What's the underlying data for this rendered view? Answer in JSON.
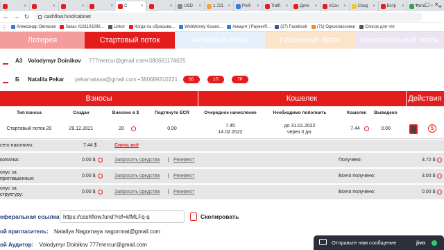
{
  "browser": {
    "tabs": [
      {
        "label": "",
        "color": "#e51c1c"
      },
      {
        "label": "",
        "color": "#e51c1c"
      },
      {
        "label": "",
        "color": "#e51c1c"
      },
      {
        "label": "",
        "color": "#e51c1c"
      },
      {
        "label": "C",
        "color": "#e51c1c",
        "active": true
      },
      {
        "label": "",
        "color": "#e51c1c"
      },
      {
        "label": "USD",
        "color": "#888888"
      },
      {
        "label": "1.721",
        "color": "#f2a33a"
      },
      {
        "label": "Profi",
        "color": "#3a7bd5"
      },
      {
        "label": "Traffi",
        "color": "#e51c1c"
      },
      {
        "label": "Дете",
        "color": "#e51c1c"
      },
      {
        "label": "#Сач",
        "color": "#e51c1c"
      },
      {
        "label": "Соед",
        "color": "#f2c43a"
      },
      {
        "label": "Встр",
        "color": "#e51c1c"
      },
      {
        "label": "Нато",
        "color": "#3a9e4f"
      }
    ],
    "url": "cashflow.fund/cabinet",
    "bookmarks": [
      {
        "label": "Александр Овласюк",
        "color": "#3a7bd5"
      },
      {
        "label": "Заказ #181103296...",
        "color": "#e51c1c"
      },
      {
        "label": "Linkor",
        "color": "#555555"
      },
      {
        "label": "Когда ты сбрасыва...",
        "color": "#e51c1c"
      },
      {
        "label": "WebMoney Кошел...",
        "color": "#3a7bd5"
      },
      {
        "label": "Аккаунт | Payeer®...",
        "color": "#3a7bd5"
      },
      {
        "label": "(27) Facebook",
        "color": "#3a5998"
      },
      {
        "label": "(71) Одноклассники",
        "color": "#f28a1c"
      },
      {
        "label": "Список для чте",
        "color": "#555555"
      }
    ]
  },
  "nav": [
    {
      "label": "Лотерея",
      "bg": "#f59d9d"
    },
    {
      "label": "Стартовый поток",
      "bg": "#e51c1c"
    },
    {
      "label": "Активный поток",
      "bg": "#e5f0fb"
    },
    {
      "label": "Пассивный поток",
      "bg": "#fbe4c8"
    },
    {
      "label": "Накопительный поток",
      "bg": "#ebe4f1"
    }
  ],
  "user": {
    "level": "А3",
    "name": "Volodymyr Doinikov",
    "email": "777mercur@gmail.com",
    "phone": "+380661174025"
  },
  "user2": {
    "level": "Б",
    "name": "Nataliia Pekar",
    "email": "pekarnatasa@gmail.com",
    "phone": "+380689310221",
    "pills": [
      "6Б",
      "1П",
      "7Р"
    ]
  },
  "table": {
    "section_titles": {
      "deposits": "Взносы",
      "wallet": "Кошелек",
      "actions": "Действия"
    },
    "headers": [
      "Тип взноса",
      "Создан",
      "Внесено в $",
      "Подтянуто ECR",
      "Очередное начисление",
      "Необходимо пополнить",
      "Кошелек",
      "Выведено"
    ],
    "row": {
      "type": "Стартовый поток 20",
      "created": "29.12.2021",
      "deposited": "20",
      "ecr": "0.00",
      "next_accrual_line1": "7.45",
      "next_accrual_line2": "14.02.2022",
      "topup_line1": "до 31.01.2022",
      "topup_line2": "через 3 дн.",
      "wallet": "7.44",
      "withdrawn": "0.00"
    }
  },
  "summary": {
    "accumulated_label": "сего накопило:",
    "accumulated_value": "7.44 $",
    "withdraw_all": "Снять всё",
    "rows": [
      {
        "label": "копилка:",
        "value": "0.00 $",
        "request": "Запросить средства",
        "reinvest": "Реинвест",
        "right_label": "Получено:",
        "right_value": "3.72 $"
      },
      {
        "label": "онус за\nприглашенных:",
        "value": "0.00 $",
        "request": "Запросить средства",
        "reinvest": "Реинвест",
        "right_label": "Всего получено:",
        "right_value": "3.00 $"
      },
      {
        "label": "онус за\nструктуру:",
        "value": "0.00 $",
        "request": "Запросить средства",
        "reinvest": "Реинвест",
        "right_label": "Всего получено:",
        "right_value": "0.00 $"
      }
    ],
    "separator": "|"
  },
  "referral": {
    "label": "еферальная ссылка",
    "value": "https://cashflow.fund?ref=kfMLFq-q",
    "copy": "Скопировать"
  },
  "inviter": {
    "label": "ой пригласитель:",
    "value": "Nataliya Nagornaya nagornnat@gmail.com"
  },
  "auditor": {
    "label": "ой Аудитор:",
    "value": "Volodymyr Doinikov 777mercur@gmail.com"
  },
  "chat": {
    "label": "Отправьте нам сообщение",
    "brand": "jivo"
  },
  "colors": {
    "accent": "#e51c1c",
    "grey": "#e6e6e6"
  }
}
